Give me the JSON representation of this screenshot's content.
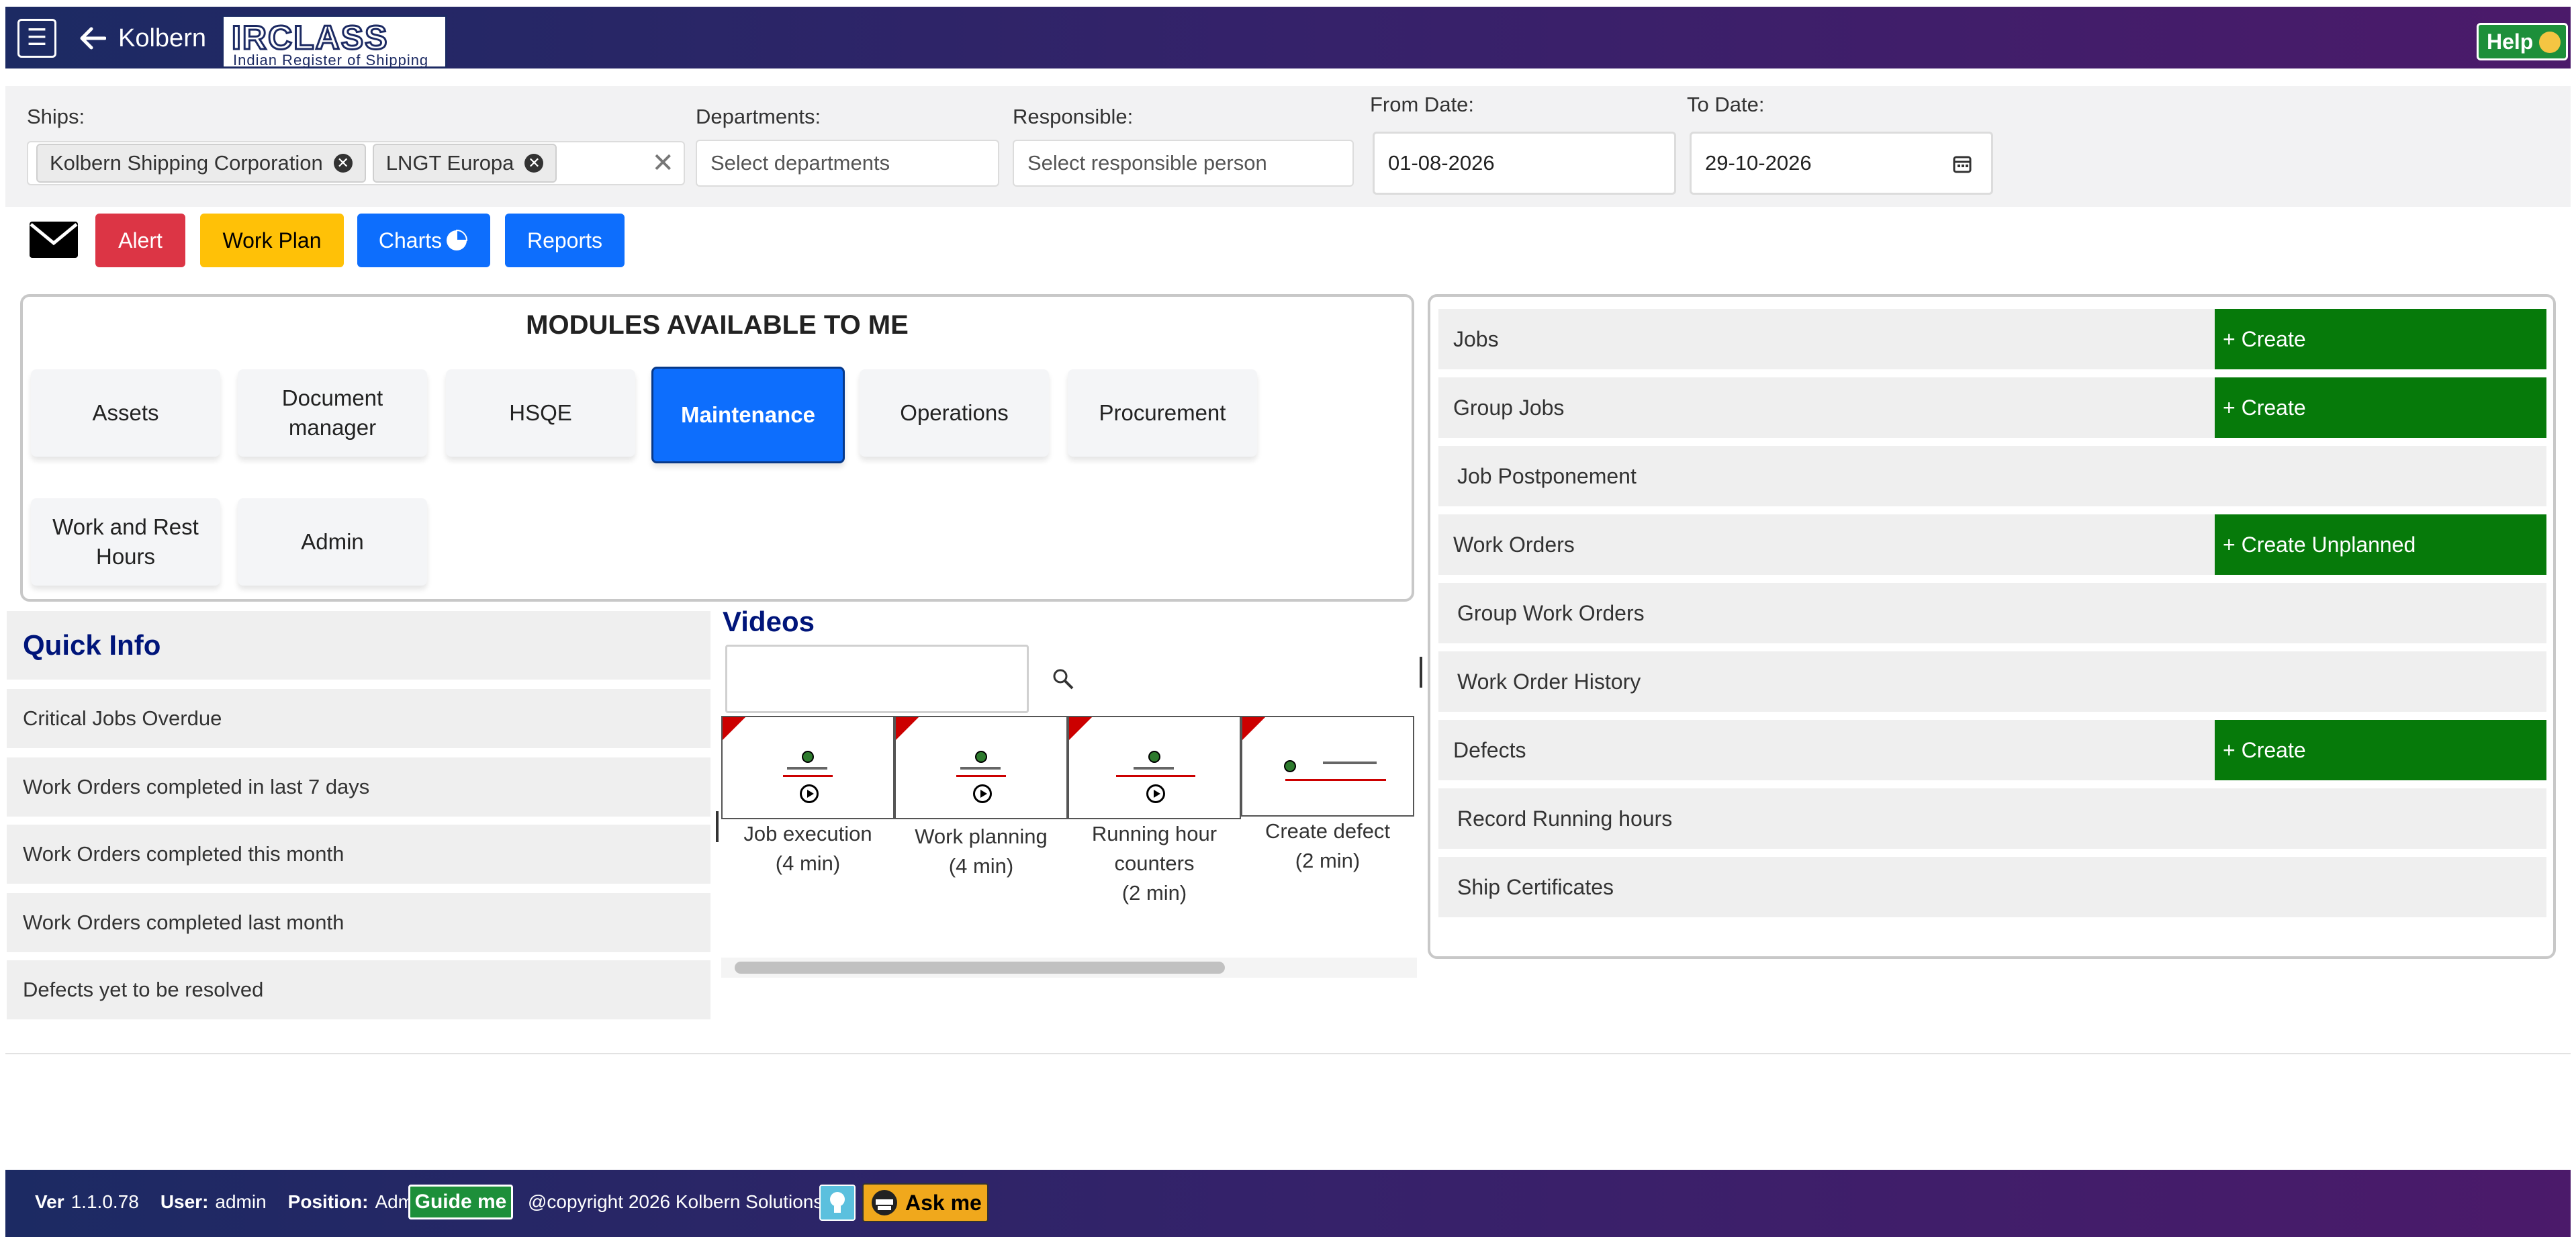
{
  "header": {
    "menu_icon": "hamburger-icon",
    "back_label": "Kolbern",
    "logo_big": "IRCLASS",
    "logo_small": "Indian Register of Shipping",
    "help_label": "Help"
  },
  "filters": {
    "ships_label": "Ships:",
    "ships_selected": [
      "Kolbern Shipping Corporation",
      "LNGT Europa"
    ],
    "departments_label": "Departments:",
    "departments_placeholder": "Select departments",
    "responsible_label": "Responsible:",
    "responsible_placeholder": "Select responsible person",
    "from_label": "From Date:",
    "from_value": "01-08-2026",
    "to_label": "To Date:",
    "to_value": "29-10-2026"
  },
  "actions": {
    "alert": "Alert",
    "work_plan": "Work Plan",
    "charts": "Charts",
    "reports": "Reports"
  },
  "modules": {
    "title": "MODULES AVAILABLE TO ME",
    "items": [
      "Assets",
      "Document manager",
      "HSQE",
      "Maintenance",
      "Operations",
      "Procurement",
      "Work and Rest Hours",
      "Admin"
    ],
    "active": "Maintenance"
  },
  "quick_info": {
    "title": "Quick Info",
    "items": [
      "Critical Jobs Overdue",
      "Work Orders completed in last 7 days",
      "Work Orders completed this month",
      "Work Orders completed last month",
      "Defects yet to be resolved"
    ]
  },
  "videos": {
    "title": "Videos",
    "items": [
      {
        "line1": "Job execution",
        "line2": "(4 min)",
        "line3": ""
      },
      {
        "line1": "Work planning",
        "line2": "(4 min)",
        "line3": ""
      },
      {
        "line1": "Running hour",
        "line2": "counters",
        "line3": "(2 min)"
      },
      {
        "line1": "Create defect",
        "line2": "(2 min)",
        "line3": ""
      }
    ]
  },
  "right_links": {
    "jobs": "Jobs",
    "group_jobs": "Group Jobs",
    "job_postponement": "Job Postponement",
    "work_orders": "Work Orders",
    "group_work_orders": "Group Work Orders",
    "work_order_history": "Work Order History",
    "defects": "Defects",
    "record_running_hours": "Record Running hours",
    "ship_certificates": "Ship Certificates",
    "create": "+ Create",
    "create_unplanned": "+ Create Unplanned"
  },
  "footer": {
    "ver_label": "Ver",
    "ver_value": "1.1.0.78",
    "user_label": "User:",
    "user_value": "admin",
    "position_label": "Position:",
    "position_value": "Admin",
    "guide_me": "Guide me",
    "copyright": "@copyright 2026 Kolbern Solutions",
    "ask_me": "Ask me"
  },
  "colors": {
    "header_gradient_start": "#1c2a63",
    "header_gradient_end": "#4b1a6a",
    "primary": "#0d6efd",
    "alert": "#dc3545",
    "warning": "#ffc107",
    "create_green": "#067a0a"
  }
}
